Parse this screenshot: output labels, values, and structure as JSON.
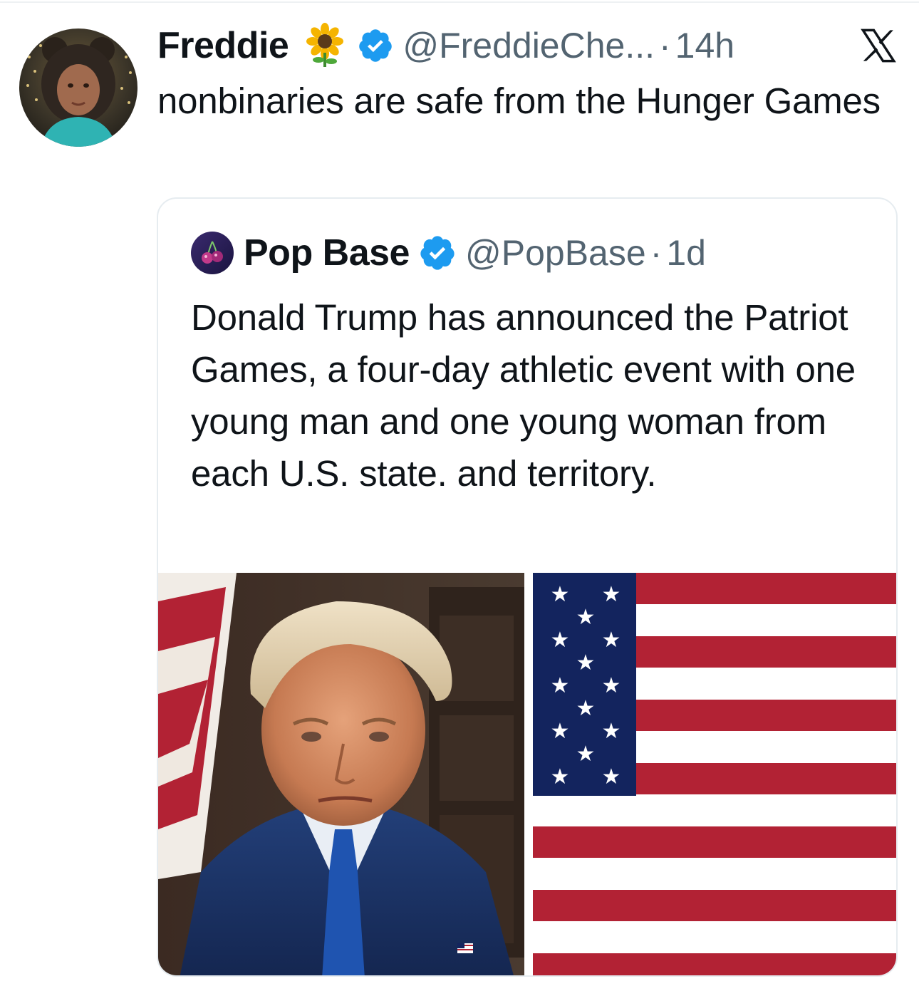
{
  "tweet": {
    "author_name": "Freddie",
    "emoji": "sunflower-icon",
    "verified": "verified-badge-icon",
    "handle": "@FreddieChe...",
    "separator": "·",
    "time": "14h",
    "platform_icon": "x-logo-icon",
    "text": "nonbinaries are safe from the Hunger Games"
  },
  "quote": {
    "author_name": "Pop Base",
    "verified": "verified-badge-icon",
    "handle": "@PopBase",
    "separator": "·",
    "time": "1d",
    "text": "Donald Trump has announced the Patriot Games, a four-day athletic event with one young man and one young woman from each U.S. state. and territory.",
    "media": [
      {
        "name": "portrait-photo"
      },
      {
        "name": "us-flag-image"
      }
    ]
  },
  "colors": {
    "text": "#0f1419",
    "secondary": "#536471",
    "verified_blue": "#1d9bf0",
    "border": "#e6ecf0",
    "flag_red": "#b22234",
    "flag_blue": "#13245e"
  }
}
